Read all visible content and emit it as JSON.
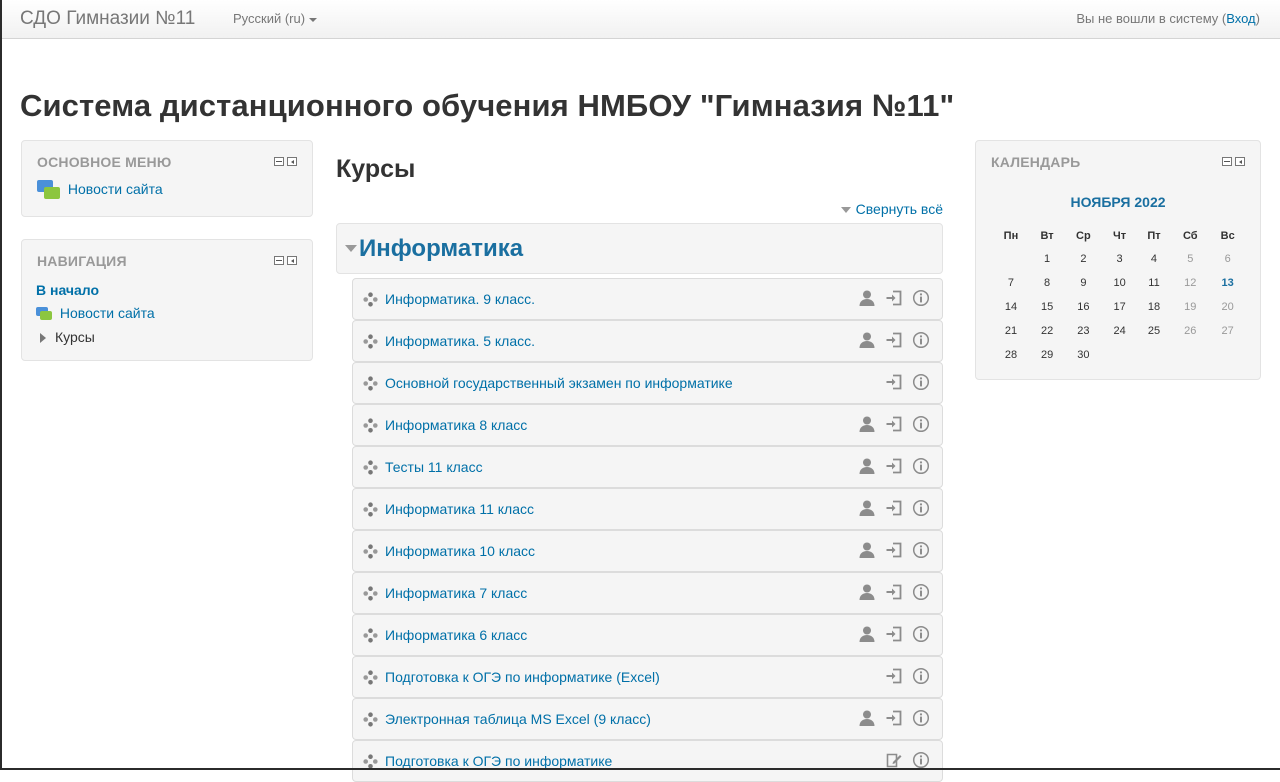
{
  "navbar": {
    "brand": "СДО Гимназии №11",
    "language": "Русский (ru)",
    "login_status": "Вы не вошли в систему (",
    "login_link": "Вход",
    "login_close": ")"
  },
  "page_title": "Система дистанционного обучения НМБОУ \"Гимназия №11\"",
  "main_menu": {
    "title": "Основное меню",
    "items": [
      "Новости сайта"
    ]
  },
  "navigation": {
    "title": "Навигация",
    "home": "В начало",
    "news": "Новости сайта",
    "courses": "Курсы"
  },
  "main": {
    "heading": "Курсы",
    "collapse_all": "Свернуть всё",
    "category": "Информатика",
    "courses": [
      {
        "name": "Информатика. 9 класс.",
        "icons": [
          "user-icon",
          "enrol-icon",
          "info-icon"
        ]
      },
      {
        "name": "Информатика. 5 класс.",
        "icons": [
          "user-icon",
          "enrol-icon",
          "info-icon"
        ]
      },
      {
        "name": "Основной государственный экзамен по информатике",
        "icons": [
          "enrol-icon",
          "info-icon"
        ]
      },
      {
        "name": "Информатика 8 класс",
        "icons": [
          "user-icon",
          "enrol-icon",
          "info-icon"
        ]
      },
      {
        "name": "Тесты 11 класс",
        "icons": [
          "user-icon",
          "enrol-icon",
          "info-icon"
        ]
      },
      {
        "name": "Информатика 11 класс",
        "icons": [
          "user-icon",
          "enrol-icon",
          "info-icon"
        ]
      },
      {
        "name": "Информатика 10 класс",
        "icons": [
          "user-icon",
          "enrol-icon",
          "info-icon"
        ]
      },
      {
        "name": "Информатика 7 класс",
        "icons": [
          "user-icon",
          "enrol-icon",
          "info-icon"
        ]
      },
      {
        "name": "Информатика 6 класс",
        "icons": [
          "user-icon",
          "enrol-icon",
          "info-icon"
        ]
      },
      {
        "name": "Подготовка к ОГЭ по информатике (Excel)",
        "icons": [
          "enrol-icon",
          "info-icon"
        ]
      },
      {
        "name": "Электронная таблица MS Excel (9 класс)",
        "icons": [
          "user-icon",
          "enrol-icon",
          "info-icon"
        ]
      },
      {
        "name": "Подготовка к ОГЭ по информатике",
        "icons": [
          "edit-icon",
          "info-icon"
        ]
      }
    ]
  },
  "calendar": {
    "title": "Календарь",
    "month": "Ноября 2022",
    "weekdays": [
      "Пн",
      "Вт",
      "Ср",
      "Чт",
      "Пт",
      "Сб",
      "Вс"
    ],
    "weeks": [
      [
        "",
        "1",
        "2",
        "3",
        "4",
        "5",
        "6"
      ],
      [
        "7",
        "8",
        "9",
        "10",
        "11",
        "12",
        "13"
      ],
      [
        "14",
        "15",
        "16",
        "17",
        "18",
        "19",
        "20"
      ],
      [
        "21",
        "22",
        "23",
        "24",
        "25",
        "26",
        "27"
      ],
      [
        "28",
        "29",
        "30",
        "",
        "",
        "",
        ""
      ]
    ],
    "today": "13"
  },
  "colors": {
    "link": "#0070a8",
    "category": "#1a6fa0",
    "block_bg": "#f5f5f5"
  }
}
